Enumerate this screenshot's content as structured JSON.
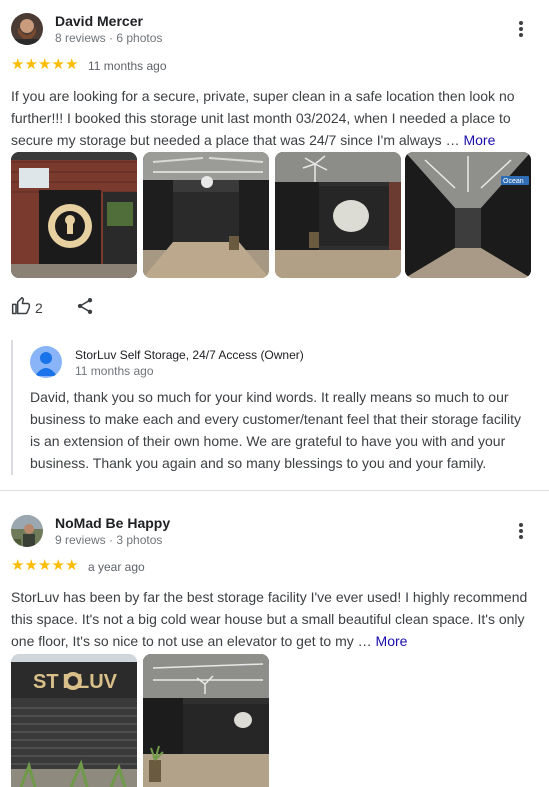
{
  "reviews": [
    {
      "name": "David Mercer",
      "meta": "8 reviews · 6 photos",
      "rating": 5,
      "time": "11 months ago",
      "text": "If you are looking for a secure, private, super clean in a safe location then look no further!!! I booked this storage unit last month 03/2024, when I needed a place to secure my storage but needed a place that was 24/7 since I'm always …",
      "more": "More",
      "likes": "2",
      "photo_sign": "Ocean",
      "owner": {
        "name": "StorLuv Self Storage, 24/7 Access (Owner)",
        "time": "11 months ago",
        "text": "David, thank you so much for your kind words. It really means so much to our business to make each and every customer/tenant feel that their storage facility is an extension of their own home. We are grateful to have you with and your business. Thank you again and so many blessings to you and your family."
      }
    },
    {
      "name": "NoMad Be Happy",
      "meta": "9 reviews · 3 photos",
      "rating": 5,
      "time": "a year ago",
      "text": "StorLuv has been by far the best storage facility I've ever used! I highly recommend this space. It's not a big cold wear house but a small beautiful clean space. It's only one floor, It's so nice to not use an elevator to get to my …",
      "more": "More",
      "photo_sign": "ST RLUV"
    }
  ],
  "colors": {
    "star": "#fbbc04",
    "link": "#1a0dab",
    "owner_avatar": "#8ab4f8"
  },
  "icons": [
    "kebab-menu-icon",
    "star-icon",
    "thumbs-up-icon",
    "share-icon",
    "person-icon"
  ]
}
